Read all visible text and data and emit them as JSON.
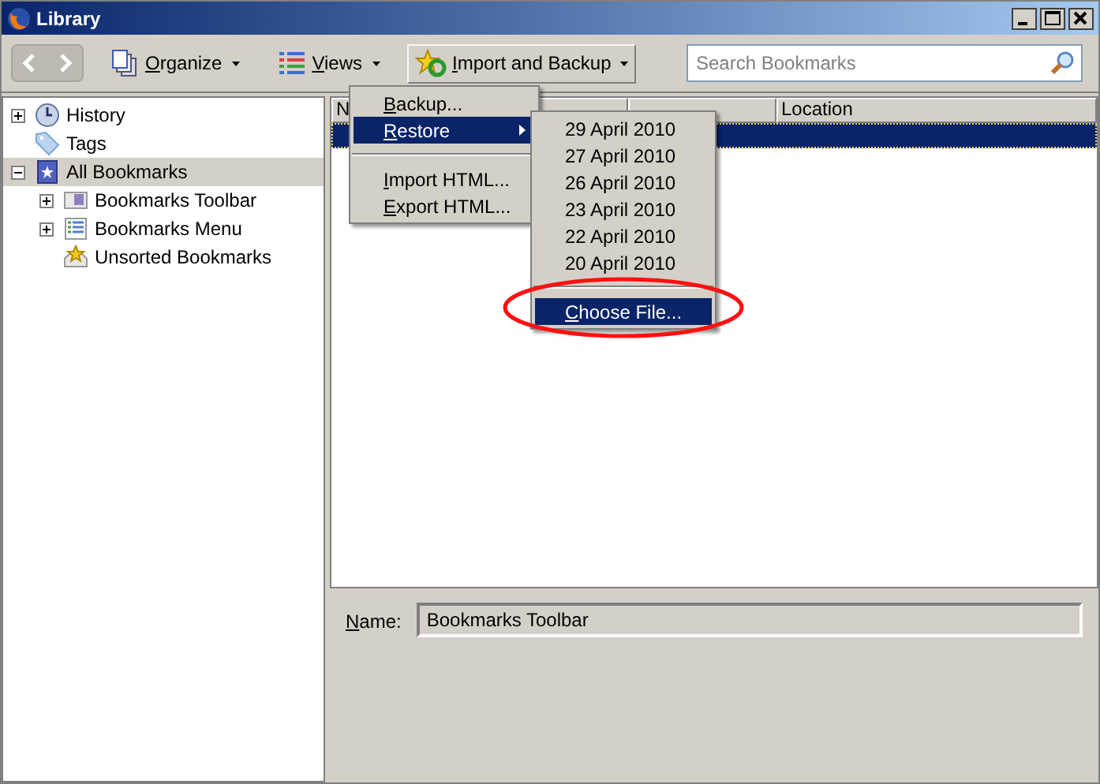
{
  "window": {
    "title": "Library"
  },
  "toolbar": {
    "buttons": [
      {
        "label": "Organize",
        "kind": "organize",
        "pressed": false
      },
      {
        "label": "Views",
        "kind": "views",
        "pressed": false
      },
      {
        "label": "Import and Backup",
        "kind": "import",
        "pressed": true
      }
    ]
  },
  "search": {
    "placeholder": "Search Bookmarks"
  },
  "sidebar": {
    "items": [
      {
        "label": "History",
        "kind": "history",
        "expanded": false,
        "selected": false
      },
      {
        "label": "Tags",
        "kind": "tag",
        "selected": false
      },
      {
        "label": "All Bookmarks",
        "kind": "all",
        "expanded": true,
        "selected": true,
        "children": [
          {
            "label": "Bookmarks Toolbar",
            "kind": "toolbar",
            "expanded": false,
            "selected": false
          },
          {
            "label": "Bookmarks Menu",
            "kind": "menu",
            "expanded": false,
            "selected": false
          },
          {
            "label": "Unsorted Bookmarks",
            "kind": "unsorted",
            "selected": false
          }
        ]
      }
    ]
  },
  "list": {
    "columns": [
      "N",
      "Location"
    ],
    "rows": [
      {
        "selected": true
      }
    ]
  },
  "details": {
    "label": "Name:",
    "value": "Bookmarks Toolbar"
  },
  "menu": {
    "items": [
      {
        "kind": "item",
        "label": "Backup...",
        "selected": false,
        "submenu": false
      },
      {
        "kind": "item",
        "label": "Restore",
        "selected": true,
        "submenu": true
      },
      {
        "kind": "separator"
      },
      {
        "kind": "item",
        "label": "Import HTML...",
        "selected": false,
        "submenu": false
      },
      {
        "kind": "item",
        "label": "Export HTML...",
        "selected": false,
        "submenu": false
      }
    ]
  },
  "submenu": {
    "items": [
      {
        "kind": "item",
        "label": "29 April 2010",
        "selected": false
      },
      {
        "kind": "item",
        "label": "27 April 2010",
        "selected": false
      },
      {
        "kind": "item",
        "label": "26 April 2010",
        "selected": false
      },
      {
        "kind": "item",
        "label": "23 April 2010",
        "selected": false
      },
      {
        "kind": "item",
        "label": "22 April 2010",
        "selected": false
      },
      {
        "kind": "item",
        "label": "20 April 2010",
        "selected": false
      },
      {
        "kind": "separator"
      },
      {
        "kind": "item",
        "label": "Choose File...",
        "selected": true
      }
    ]
  }
}
